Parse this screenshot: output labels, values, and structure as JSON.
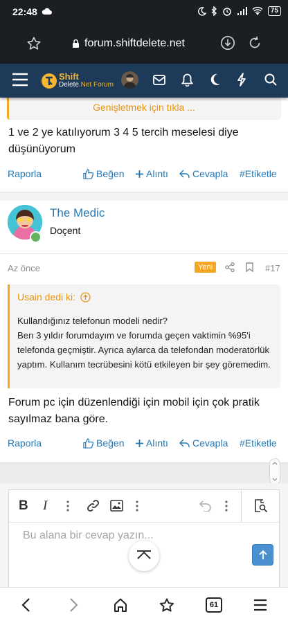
{
  "status_bar": {
    "time": "22:48",
    "battery": "75"
  },
  "browser": {
    "url": "forum.shiftdelete.net"
  },
  "site": {
    "logo_main": "Shift",
    "logo_sub_a": "Delete",
    "logo_sub_b": ".Net Forum"
  },
  "previous_post": {
    "expand_label": "Genişletmek için tıkla ...",
    "body": "1 ve 2 ye katılıyorum 3 4 5 tercih meselesi diye düşünüyorum",
    "actions": {
      "report": "Raporla",
      "like": "Beğen",
      "quote": "Alıntı",
      "reply": "Cevapla",
      "tag": "#Etiketle"
    }
  },
  "post": {
    "username": "The Medic",
    "user_title": "Doçent",
    "time": "Az önce",
    "new_badge": "Yeni",
    "number": "#17",
    "quote_author": "Usain dedi ki:",
    "quote_body": "Kullandığınız telefonun modeli nedir?\nBen 3 yıldır forumdayım ve forumda geçen vaktimin %95'i telefonda geçmiştir. Ayrıca aylarca da telefondan moderatörlük yaptım. Kullanım tecrübesini kötü etkileyen bir şey göremedim.",
    "body": "Forum pc için düzenlendiği için mobil için çok pratik sayılmaz bana göre.",
    "actions": {
      "report": "Raporla",
      "like": "Beğen",
      "quote": "Alıntı",
      "reply": "Cevapla",
      "tag": "#Etiketle"
    }
  },
  "editor": {
    "placeholder": "Bu alana bir cevap yazın..."
  },
  "nav": {
    "tabs_count": "61"
  },
  "colors": {
    "header": "#1d3a58",
    "accent": "#f5a623",
    "link": "#2577b1",
    "online": "#63b35e"
  }
}
